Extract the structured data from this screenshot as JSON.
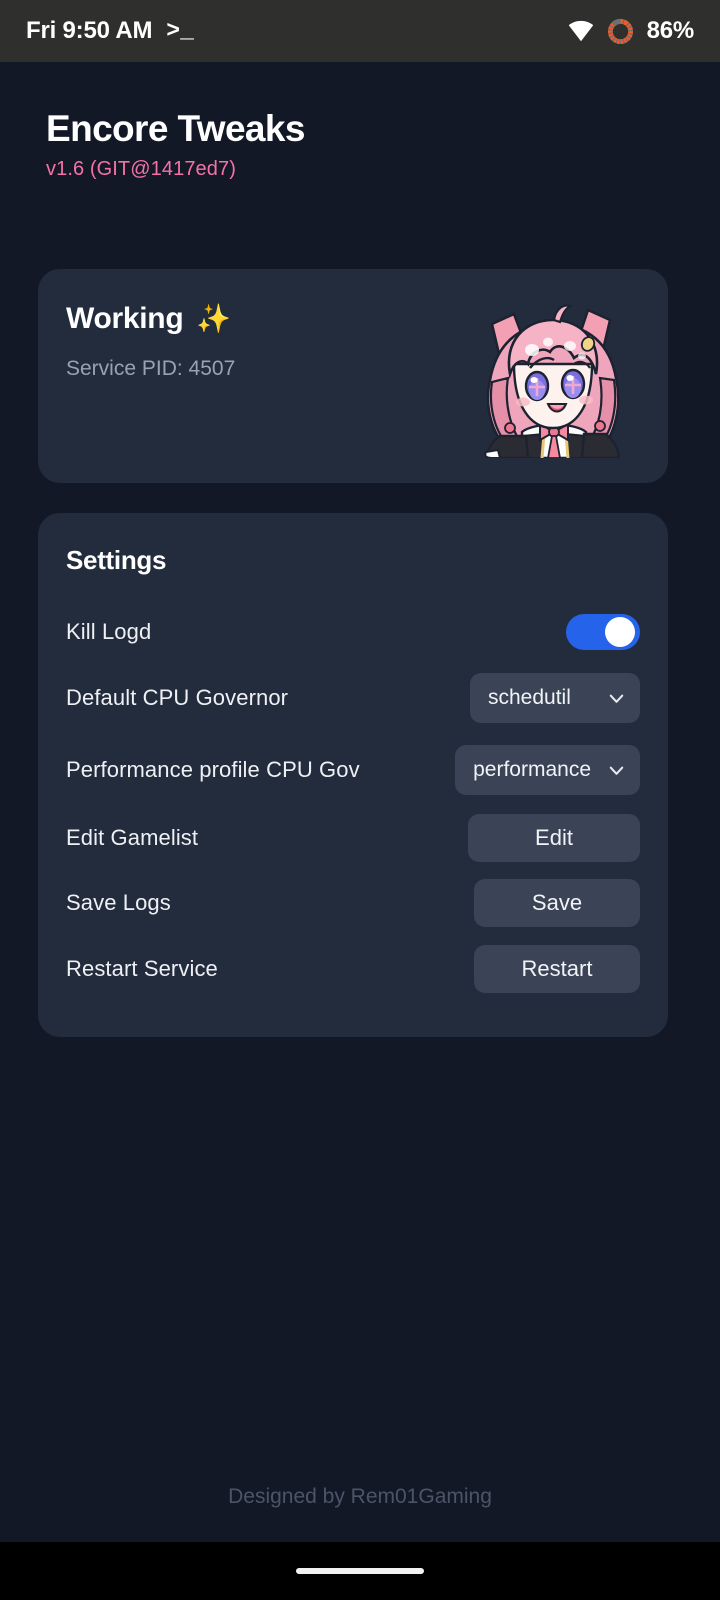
{
  "status_bar": {
    "clock": "Fri 9:50 AM",
    "terminal_icon": "terminal-prompt-icon",
    "terminal_glyph": ">_",
    "wifi_icon": "wifi-icon",
    "battery_icon": "battery-ring-icon",
    "battery_percent": "86%",
    "battery_level": 86,
    "bar_background": "#2f2f2e",
    "battery_accent": "#f05a28"
  },
  "header": {
    "title": "Encore Tweaks",
    "version": "v1.6 (GIT@1417ed7)",
    "version_color": "#f472a8"
  },
  "status_card": {
    "heading": "Working",
    "heading_emoji": "✨",
    "pid_label": "Service PID: 4507",
    "mascot_icon": "anime-mascot-illustration",
    "card_background": "#232c3d"
  },
  "settings": {
    "heading": "Settings",
    "rows": [
      {
        "label": "Kill Logd",
        "control": "toggle",
        "value": "on",
        "accent": "#2563eb"
      },
      {
        "label": "Default CPU Governor",
        "control": "dropdown",
        "value": "schedutil",
        "icon": "chevron-down-icon"
      },
      {
        "label": "Performance profile CPU Gov",
        "control": "dropdown",
        "value": "performance",
        "icon": "chevron-down-icon"
      },
      {
        "label": "Edit Gamelist",
        "control": "button",
        "value": "Edit"
      },
      {
        "label": "Save Logs",
        "control": "button",
        "value": "Save"
      },
      {
        "label": "Restart Service",
        "control": "button",
        "value": "Restart"
      }
    ]
  },
  "footer": {
    "credit": "Designed by Rem01Gaming"
  },
  "nav_bar": {
    "home_indicator": "home-pill-indicator"
  },
  "theme": {
    "page_background": "#121826",
    "card_background": "#232c3d",
    "control_background": "#3a4456",
    "text_primary": "#ffffff",
    "text_secondary": "#9aa2b1",
    "text_muted": "#4b5568"
  }
}
